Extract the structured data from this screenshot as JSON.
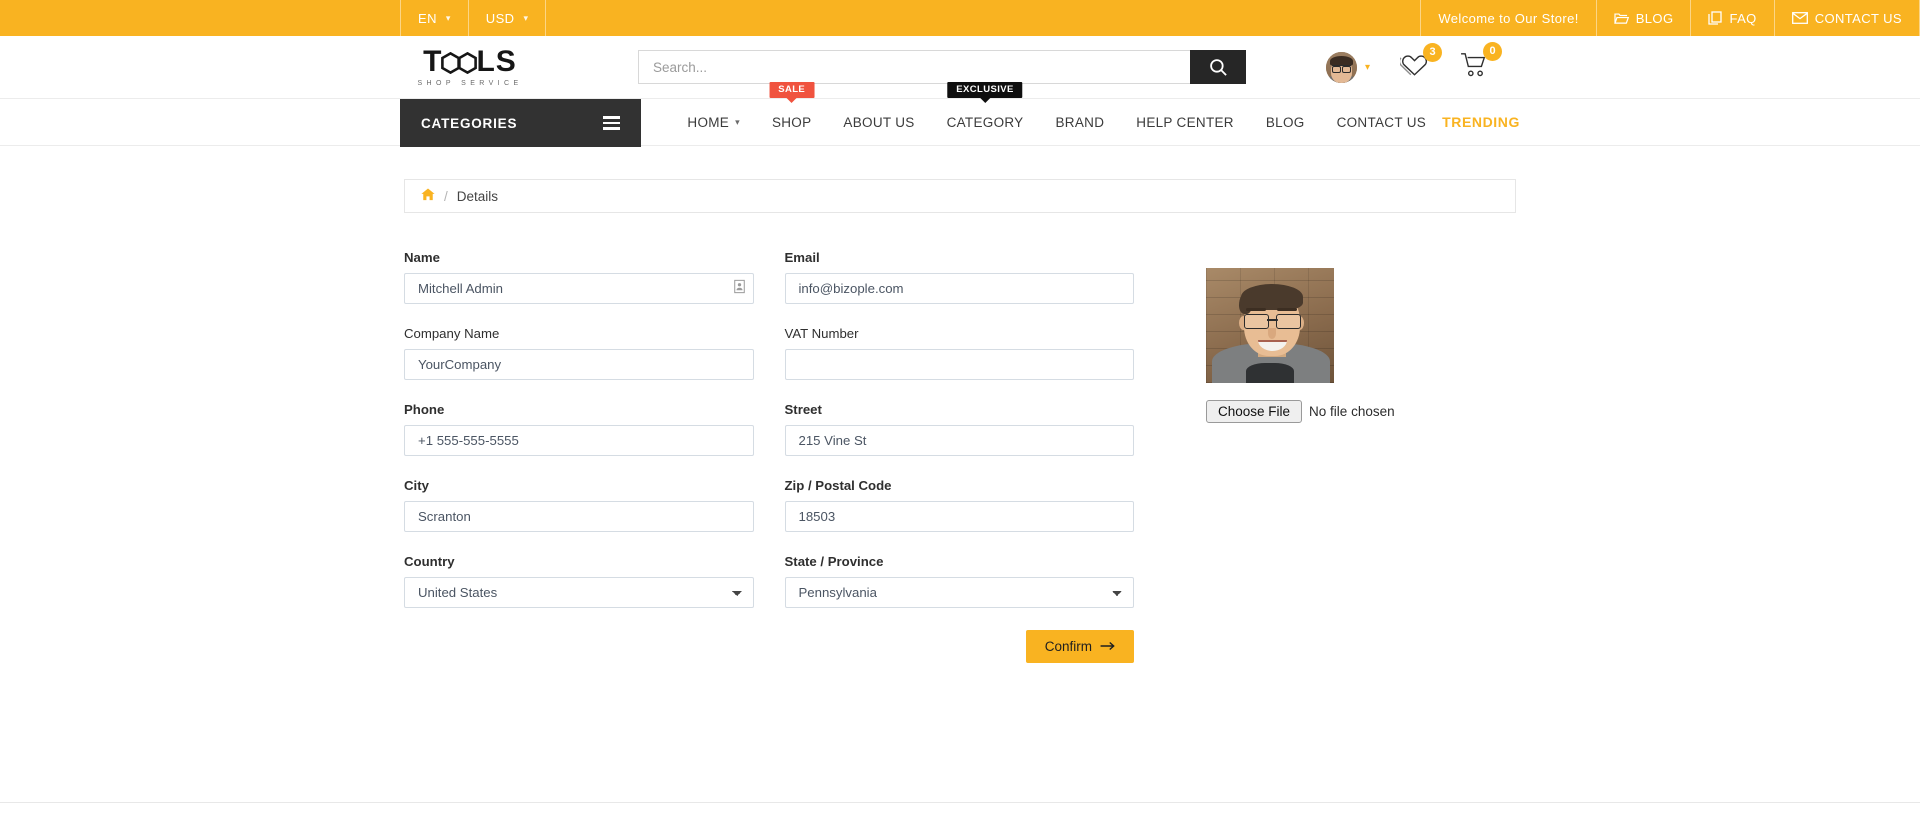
{
  "topbar": {
    "language": {
      "label": "EN",
      "icon": "chevron-down-icon"
    },
    "currency": {
      "label": "USD",
      "icon": "chevron-down-icon"
    },
    "welcome": "Welcome to Our Store!",
    "links": [
      {
        "label": "BLOG",
        "icon": "folder-open-icon"
      },
      {
        "label": "FAQ",
        "icon": "copy-pages-icon"
      },
      {
        "label": "CONTACT US",
        "icon": "envelope-icon"
      }
    ],
    "bg_color": "#f9b321"
  },
  "header": {
    "logo": {
      "main": "TOOLS",
      "sub": "SHOP SERVICE"
    },
    "search": {
      "placeholder": "Search...",
      "value": "",
      "icon": "search-icon"
    },
    "account": {
      "icon": "avatar",
      "caret": "chevron-down-icon"
    },
    "wishlist": {
      "icon": "heart-icon",
      "count": "3"
    },
    "cart": {
      "icon": "cart-icon",
      "count": "0"
    }
  },
  "nav": {
    "categories_label": "CATEGORIES",
    "categories_icon": "hamburger-icon",
    "items": [
      {
        "label": "HOME",
        "caret": true,
        "badge": null
      },
      {
        "label": "SHOP",
        "caret": false,
        "badge": "SALE",
        "badge_type": "sale"
      },
      {
        "label": "ABOUT US",
        "caret": false,
        "badge": null
      },
      {
        "label": "CATEGORY",
        "caret": false,
        "badge": "EXCLUSIVE",
        "badge_type": "exclusive"
      },
      {
        "label": "BRAND",
        "caret": false,
        "badge": null
      },
      {
        "label": "HELP CENTER",
        "caret": false,
        "badge": null
      },
      {
        "label": "BLOG",
        "caret": false,
        "badge": null
      },
      {
        "label": "CONTACT US",
        "caret": false,
        "badge": null
      }
    ],
    "trending": "TRENDING",
    "trending_color": "#f9b321",
    "sale_color": "#f0533f",
    "exclusive_color": "#0f0f0f"
  },
  "breadcrumb": {
    "home_icon": "home-icon",
    "separator": "/",
    "current": "Details"
  },
  "form": {
    "fields": [
      {
        "label": "Name",
        "value": "Mitchell Admin",
        "bold": true,
        "type": "text",
        "icon": "contact-card-icon"
      },
      {
        "label": "Email",
        "value": "info@bizople.com",
        "bold": true,
        "type": "text",
        "icon": null
      },
      {
        "label": "Company Name",
        "value": "YourCompany",
        "bold": false,
        "type": "text",
        "icon": null
      },
      {
        "label": "VAT Number",
        "value": "",
        "bold": false,
        "type": "text",
        "icon": null
      },
      {
        "label": "Phone",
        "value": "+1 555-555-5555",
        "bold": true,
        "type": "text",
        "icon": null
      },
      {
        "label": "Street",
        "value": "215 Vine St",
        "bold": true,
        "type": "text",
        "icon": null
      },
      {
        "label": "City",
        "value": "Scranton",
        "bold": true,
        "type": "text",
        "icon": null
      },
      {
        "label": "Zip / Postal Code",
        "value": "18503",
        "bold": true,
        "type": "text",
        "icon": null
      },
      {
        "label": "Country",
        "value": "United States",
        "bold": true,
        "type": "select",
        "icon": "chevron-down-icon"
      },
      {
        "label": "State / Province",
        "value": "Pennsylvania",
        "bold": true,
        "type": "select",
        "icon": "chevron-down-icon"
      }
    ],
    "confirm_label": "Confirm",
    "confirm_icon": "arrow-right-icon",
    "confirm_color": "#f9b321"
  },
  "photo": {
    "alt": "profile-photo-man-with-glasses",
    "choose_file_label": "Choose File",
    "no_file_label": "No file chosen"
  }
}
